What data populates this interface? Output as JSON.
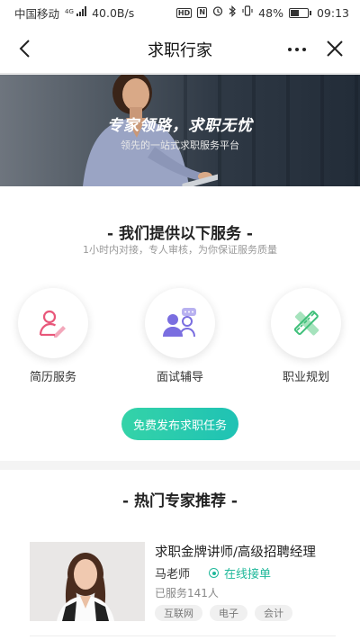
{
  "status_bar": {
    "carrier": "中国移动",
    "network": "4G",
    "speed": "40.0B/s",
    "battery": "48%",
    "battery_level": 0.48,
    "time": "09:13",
    "icons": [
      "hd-icon",
      "nfc-icon",
      "alarm-icon",
      "bluetooth-icon",
      "vibrate-icon",
      "battery-icon"
    ]
  },
  "navbar": {
    "title": "求职行家",
    "back_icon": "chevron-left-icon",
    "more_icon": "more-dots-icon",
    "close_icon": "close-icon"
  },
  "banner": {
    "headline": "专家领路，求职无忧",
    "subtitle": "领先的一站式求职服务平台"
  },
  "services": {
    "title": "- 我们提供以下服务 -",
    "subtitle": "1小时内对接，专人审核，为你保证服务质量",
    "items": [
      {
        "label": "简历服务",
        "icon": "resume-user-icon",
        "color": "#e8577a"
      },
      {
        "label": "面试辅导",
        "icon": "interview-people-icon",
        "color": "#7a6ee0"
      },
      {
        "label": "职业规划",
        "icon": "ruler-pencil-icon",
        "color": "#3fc07a"
      }
    ],
    "cta_label": "免费发布求职任务"
  },
  "experts": {
    "title": "- 热门专家推荐 -",
    "list": [
      {
        "title": "求职金牌讲师/高级招聘经理",
        "name": "马老师",
        "status": "在线接单",
        "served": "已服务141人",
        "tags": [
          "互联网",
          "电子",
          "会计"
        ]
      }
    ]
  },
  "colors": {
    "accent": "#1fc2b4",
    "status_green": "#1fb89a"
  }
}
